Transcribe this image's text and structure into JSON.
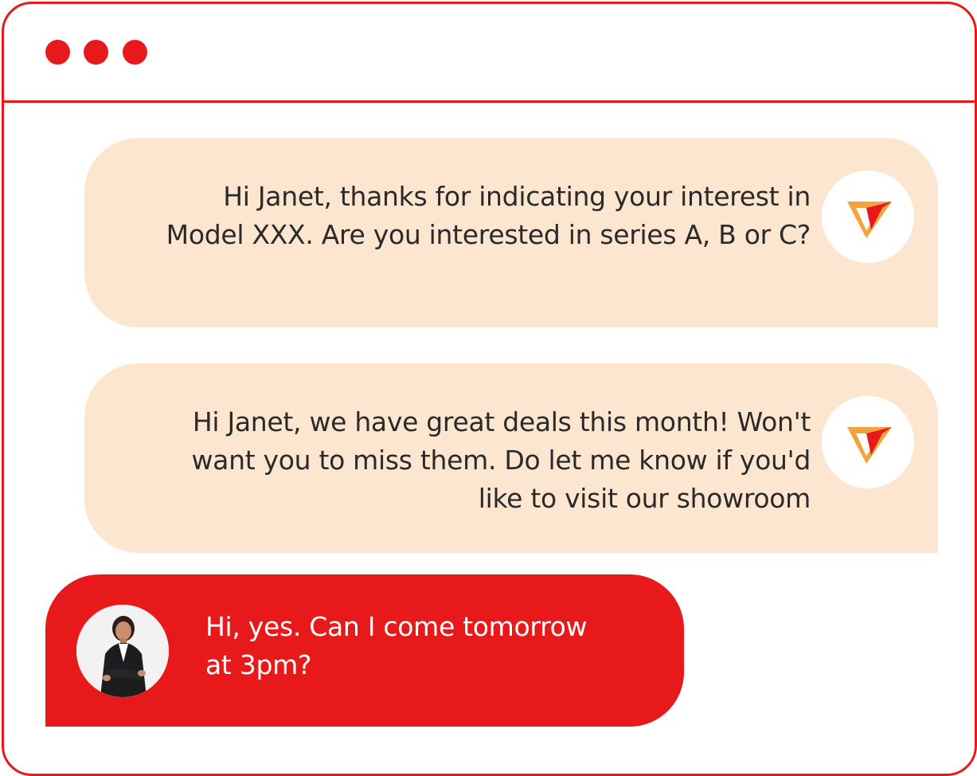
{
  "window": {
    "controls": [
      "close",
      "minimize",
      "maximize"
    ]
  },
  "colors": {
    "accent": "#e8191b",
    "agent_bubble": "#fde6cf",
    "agent_text": "#2a2a2a",
    "user_text": "#ffffff",
    "logo_orange": "#f4a23b",
    "logo_red": "#e8191b"
  },
  "messages": [
    {
      "sender": "agent",
      "avatar_icon": "brand-logo-icon",
      "text": "Hi Janet, thanks for indicating your interest in\nModel XXX. Are you interested in series A, B or C?"
    },
    {
      "sender": "agent",
      "avatar_icon": "brand-logo-icon",
      "text": "Hi Janet, we have great deals this month! Won't\nwant you to miss them. Do let me know if you'd\nlike to visit our showroom"
    },
    {
      "sender": "user",
      "avatar_icon": "user-photo-avatar",
      "text": "Hi, yes. Can I come tomorrow\nat 3pm?"
    }
  ]
}
